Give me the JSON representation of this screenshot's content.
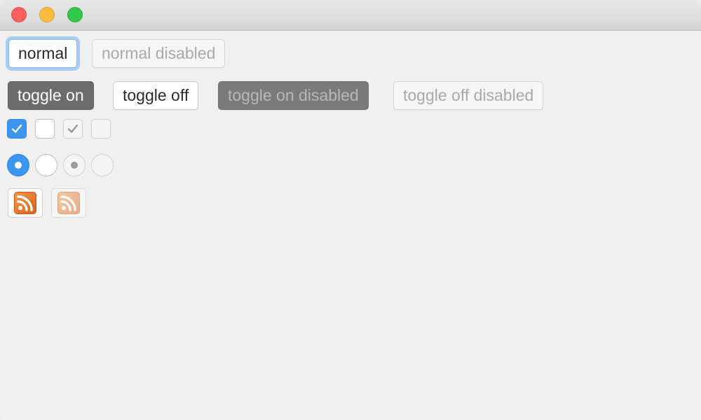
{
  "window": {
    "traffic_lights": {
      "close": {
        "icon": "close-light-icon",
        "color": "#fc605c"
      },
      "minimize": {
        "icon": "minimize-light-icon",
        "color": "#fdbc40"
      },
      "maximize": {
        "icon": "maximize-light-icon",
        "color": "#34c84a"
      }
    }
  },
  "buttons": {
    "normal_label": "normal",
    "normal_disabled_label": "normal disabled"
  },
  "toggles": {
    "on_label": "toggle on",
    "off_label": "toggle off",
    "on_disabled_label": "toggle on disabled",
    "off_disabled_label": "toggle off disabled"
  },
  "checkboxes": [
    {
      "state": "checked",
      "enabled": true
    },
    {
      "state": "unchecked",
      "enabled": true
    },
    {
      "state": "checked",
      "enabled": false
    },
    {
      "state": "unchecked",
      "enabled": false
    }
  ],
  "radios": [
    {
      "state": "selected",
      "enabled": true
    },
    {
      "state": "unselected",
      "enabled": true
    },
    {
      "state": "selected",
      "enabled": false
    },
    {
      "state": "unselected",
      "enabled": false
    }
  ],
  "icon_buttons": [
    {
      "icon": "rss-icon",
      "enabled": true
    },
    {
      "icon": "rss-icon",
      "enabled": false
    }
  ],
  "colors": {
    "accent": "#3b95f1",
    "focus_ring": "#a9cdf5",
    "toggle_on": "#6c6c6c",
    "rss_orange": "#e8762b"
  }
}
